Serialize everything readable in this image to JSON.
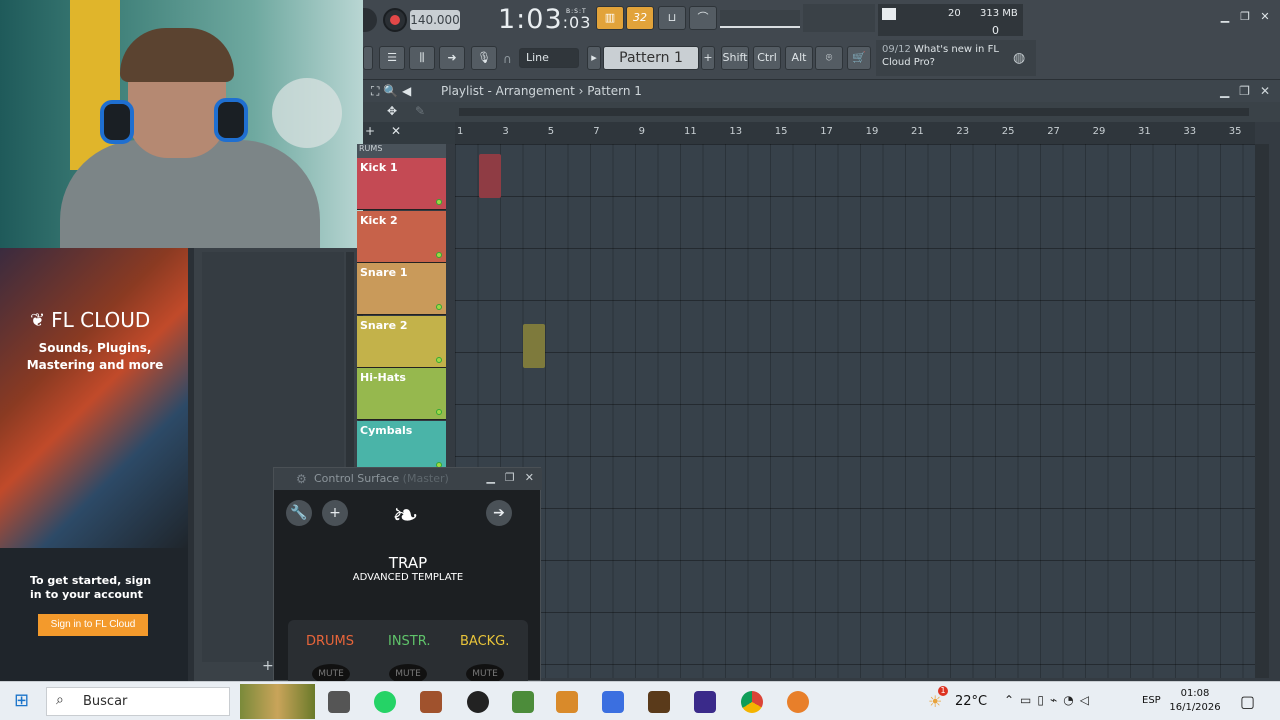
{
  "webcam": {
    "label": "webcam-overlay"
  },
  "fl_cloud": {
    "brand": "FL CLOUD",
    "tagline": "Sounds, Plugins, Mastering and more",
    "get_started": "To get started, sign in to your account",
    "sign_in_button": "Sign in to FL Cloud"
  },
  "toolbar": {
    "bpm": "140.000",
    "time_main": "1:03",
    "time_sub": ":03",
    "time_label": "B:S:T",
    "snap": "Line",
    "pattern": "Pattern 1",
    "shift": "Shift",
    "ctrl": "Ctrl",
    "alt": "Alt",
    "cpu": "20",
    "memory": "313 MB",
    "voices": "0",
    "news_index": "09/12",
    "news_text": "What's new in FL Cloud Pro?",
    "step_count": "32"
  },
  "playlist": {
    "title_prefix": "Playlist - Arrangement",
    "separator": "›",
    "pattern": "Pattern 1",
    "ruler_ticks": [
      "1",
      "3",
      "5",
      "7",
      "9",
      "11",
      "13",
      "15",
      "17",
      "19",
      "21",
      "23",
      "25",
      "27",
      "29",
      "31",
      "33",
      "35"
    ],
    "group_label": "RUMS",
    "tracks": [
      {
        "name": "Kick 1",
        "color": "#c44a54"
      },
      {
        "name": "Kick 2",
        "color": "#c7624a"
      },
      {
        "name": "Snare 1",
        "color": "#c99a5a"
      },
      {
        "name": "Snare 2",
        "color": "#c3b24a"
      },
      {
        "name": "Hi-Hats",
        "color": "#96b84e"
      },
      {
        "name": "Cymbals",
        "color": "#4ab4a8"
      }
    ]
  },
  "control_surface": {
    "title": "Control Surface",
    "target": "(Master)",
    "trap": "TRAP",
    "subtitle": "ADVANCED TEMPLATE",
    "groups": [
      {
        "label": "DRUMS",
        "color": "#e8653a"
      },
      {
        "label": "INSTR.",
        "color": "#5fc36a"
      },
      {
        "label": "BACKG.",
        "color": "#e8c43a"
      }
    ],
    "mute": "MUTE"
  },
  "taskbar": {
    "search_placeholder": "Buscar",
    "temperature": "22°C",
    "weather_badge": "1",
    "language": "ESP",
    "time": "01:08",
    "date": "16/1/2026"
  }
}
